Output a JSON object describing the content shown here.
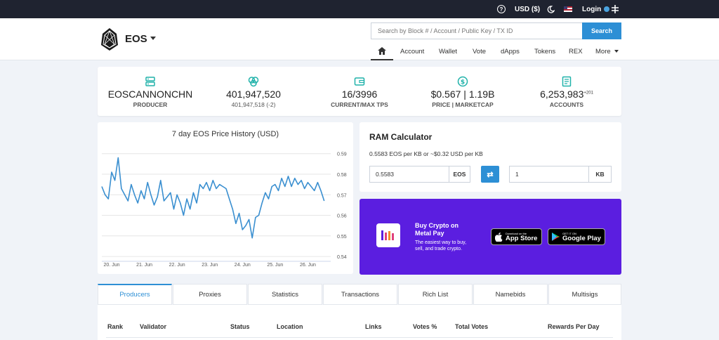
{
  "topbar": {
    "currency": "USD ($)",
    "login": "Login"
  },
  "header": {
    "brand": "EOS",
    "search_placeholder": "Search by Block # / Account / Public Key / TX ID",
    "search_button": "Search",
    "nav": [
      "Account",
      "Wallet",
      "Vote",
      "dApps",
      "Tokens",
      "REX",
      "More"
    ]
  },
  "stats": [
    {
      "icon": "server-icon",
      "value": "EOSCANNONCHN",
      "label": "PRODUCER"
    },
    {
      "icon": "blocks-icon",
      "value": "401,947,520",
      "subvalue": "401,947,518 (-2)"
    },
    {
      "icon": "wallet-icon",
      "value": "16/3996",
      "label": "CURRENT/MAX TPS"
    },
    {
      "icon": "dollar-icon",
      "value": "$0.567 | 1.19B",
      "label": "PRICE | MARKETCAP"
    },
    {
      "icon": "accounts-icon",
      "value": "6,253,983",
      "sup": "+201",
      "label": "ACCOUNTS"
    }
  ],
  "chart_data": {
    "type": "line",
    "title": "7 day EOS Price History (USD)",
    "xlabel": "",
    "ylabel": "",
    "x_ticks": [
      "20. Jun",
      "21. Jun",
      "22. Jun",
      "23. Jun",
      "24. Jun",
      "25. Jun",
      "26. Jun"
    ],
    "y_ticks": [
      0.54,
      0.55,
      0.56,
      0.57,
      0.58,
      0.59
    ],
    "ylim": [
      0.539,
      0.594
    ],
    "xlim": [
      0,
      7
    ],
    "grid": true,
    "x": [
      0,
      0.1,
      0.2,
      0.3,
      0.4,
      0.5,
      0.6,
      0.7,
      0.8,
      0.9,
      1.0,
      1.1,
      1.2,
      1.3,
      1.4,
      1.5,
      1.6,
      1.7,
      1.8,
      1.9,
      2.0,
      2.1,
      2.2,
      2.3,
      2.4,
      2.5,
      2.6,
      2.7,
      2.8,
      2.9,
      3.0,
      3.1,
      3.2,
      3.3,
      3.4,
      3.5,
      3.6,
      3.7,
      3.8,
      3.9,
      4.0,
      4.1,
      4.2,
      4.3,
      4.4,
      4.5,
      4.6,
      4.7,
      4.8,
      4.9,
      5.0,
      5.1,
      5.2,
      5.3,
      5.4,
      5.5,
      5.6,
      5.7,
      5.8,
      5.9,
      6.0,
      6.1,
      6.2,
      6.3,
      6.4,
      6.5,
      6.6,
      6.7,
      6.8
    ],
    "values": [
      0.574,
      0.57,
      0.568,
      0.581,
      0.577,
      0.588,
      0.573,
      0.57,
      0.567,
      0.575,
      0.57,
      0.566,
      0.572,
      0.568,
      0.576,
      0.57,
      0.565,
      0.569,
      0.577,
      0.567,
      0.569,
      0.571,
      0.563,
      0.57,
      0.566,
      0.56,
      0.568,
      0.563,
      0.571,
      0.566,
      0.575,
      0.573,
      0.576,
      0.572,
      0.577,
      0.573,
      0.575,
      0.574,
      0.573,
      0.568,
      0.563,
      0.556,
      0.561,
      0.553,
      0.555,
      0.558,
      0.549,
      0.559,
      0.56,
      0.566,
      0.571,
      0.568,
      0.574,
      0.575,
      0.572,
      0.578,
      0.574,
      0.579,
      0.574,
      0.578,
      0.575,
      0.577,
      0.573,
      0.576,
      0.574,
      0.572,
      0.576,
      0.572,
      0.567
    ]
  },
  "ram": {
    "title": "RAM Calculator",
    "subtitle": "0.5583 EOS per KB or ~$0.32 USD per KB",
    "eos_value": "0.5583",
    "eos_unit": "EOS",
    "kb_value": "1",
    "kb_unit": "KB"
  },
  "promo": {
    "title": "Buy Crypto on Metal Pay",
    "text": "The easiest way to buy, sell, and trade crypto.",
    "appstore_small": "Download on the",
    "appstore_big": "App Store",
    "googleplay_small": "GET IT ON",
    "googleplay_big": "Google Play",
    "bg_color": "#5b1ee0"
  },
  "tabs": [
    "Producers",
    "Proxies",
    "Statistics",
    "Transactions",
    "Rich List",
    "Namebids",
    "Multisigs"
  ],
  "table_headers": [
    "Rank",
    "Validator",
    "Status",
    "Location",
    "Links",
    "Votes %",
    "Total Votes",
    "Rewards Per Day"
  ],
  "colors": {
    "accent": "#2d8fd5",
    "line": "#3a8fd0",
    "topbar": "#1f2330"
  }
}
